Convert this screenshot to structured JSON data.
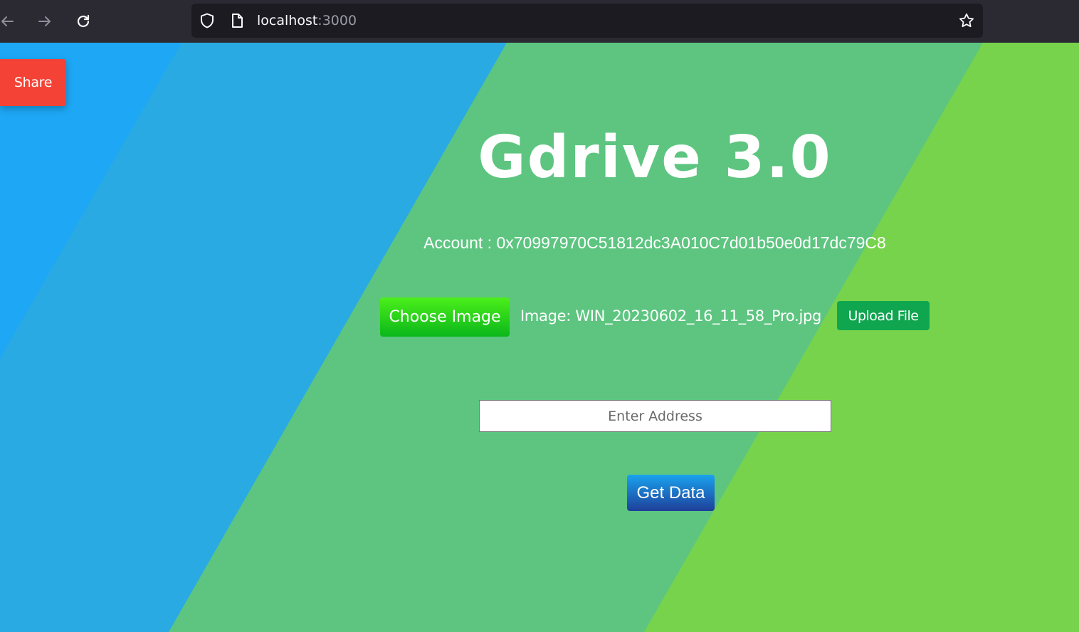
{
  "browser": {
    "url_host": "localhost",
    "url_port": ":3000"
  },
  "page": {
    "share_label": "Share",
    "title": "Gdrive 3.0",
    "account_text": "Account : 0x70997970C51812dc3A010C7d01b50e0d17dc79C8",
    "choose_image_label": "Choose Image",
    "image_text": "Image: WIN_20230602_16_11_58_Pro.jpg",
    "upload_label": "Upload File",
    "address_placeholder": "Enter Address",
    "get_data_label": "Get Data"
  },
  "colors": {
    "stripe_blue": "#1da7f5",
    "stripe_cyan": "#2aaae2",
    "stripe_teal": "#5dc580",
    "stripe_green": "#77d34c",
    "share": "#f44336",
    "upload": "#10a650"
  },
  "icons": {
    "back": "arrow-left-icon",
    "forward": "arrow-right-icon",
    "reload": "reload-icon",
    "shield": "shield-icon",
    "page": "page-icon",
    "bookmark": "star-icon"
  }
}
